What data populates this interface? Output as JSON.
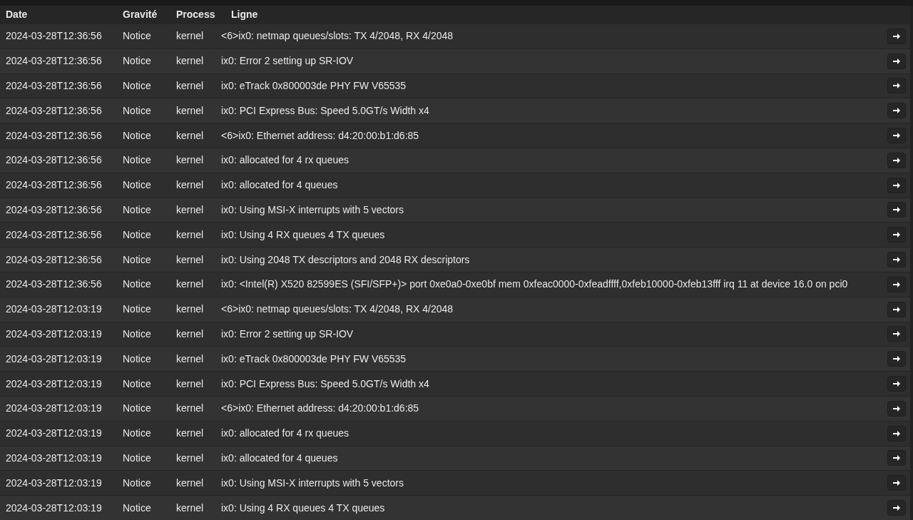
{
  "table": {
    "columns": [
      "Date",
      "Gravité",
      "Process",
      "Ligne"
    ],
    "rows": [
      {
        "date": "2024-03-28T12:36:56",
        "severity": "Notice",
        "process": "kernel",
        "line": "<6>ix0: netmap queues/slots: TX 4/2048, RX 4/2048"
      },
      {
        "date": "2024-03-28T12:36:56",
        "severity": "Notice",
        "process": "kernel",
        "line": "ix0: Error 2 setting up SR-IOV"
      },
      {
        "date": "2024-03-28T12:36:56",
        "severity": "Notice",
        "process": "kernel",
        "line": "ix0: eTrack 0x800003de PHY FW V65535"
      },
      {
        "date": "2024-03-28T12:36:56",
        "severity": "Notice",
        "process": "kernel",
        "line": "ix0: PCI Express Bus: Speed 5.0GT/s Width x4"
      },
      {
        "date": "2024-03-28T12:36:56",
        "severity": "Notice",
        "process": "kernel",
        "line": "<6>ix0: Ethernet address: d4:20:00:b1:d6:85"
      },
      {
        "date": "2024-03-28T12:36:56",
        "severity": "Notice",
        "process": "kernel",
        "line": "ix0: allocated for 4 rx queues"
      },
      {
        "date": "2024-03-28T12:36:56",
        "severity": "Notice",
        "process": "kernel",
        "line": "ix0: allocated for 4 queues"
      },
      {
        "date": "2024-03-28T12:36:56",
        "severity": "Notice",
        "process": "kernel",
        "line": "ix0: Using MSI-X interrupts with 5 vectors"
      },
      {
        "date": "2024-03-28T12:36:56",
        "severity": "Notice",
        "process": "kernel",
        "line": "ix0: Using 4 RX queues 4 TX queues"
      },
      {
        "date": "2024-03-28T12:36:56",
        "severity": "Notice",
        "process": "kernel",
        "line": "ix0: Using 2048 TX descriptors and 2048 RX descriptors"
      },
      {
        "date": "2024-03-28T12:36:56",
        "severity": "Notice",
        "process": "kernel",
        "line": "ix0: <Intel(R) X520 82599ES (SFI/SFP+)> port 0xe0a0-0xe0bf mem 0xfeac0000-0xfeadffff,0xfeb10000-0xfeb13fff irq 11 at device 16.0 on pci0"
      },
      {
        "date": "2024-03-28T12:03:19",
        "severity": "Notice",
        "process": "kernel",
        "line": "<6>ix0: netmap queues/slots: TX 4/2048, RX 4/2048"
      },
      {
        "date": "2024-03-28T12:03:19",
        "severity": "Notice",
        "process": "kernel",
        "line": "ix0: Error 2 setting up SR-IOV"
      },
      {
        "date": "2024-03-28T12:03:19",
        "severity": "Notice",
        "process": "kernel",
        "line": "ix0: eTrack 0x800003de PHY FW V65535"
      },
      {
        "date": "2024-03-28T12:03:19",
        "severity": "Notice",
        "process": "kernel",
        "line": "ix0: PCI Express Bus: Speed 5.0GT/s Width x4"
      },
      {
        "date": "2024-03-28T12:03:19",
        "severity": "Notice",
        "process": "kernel",
        "line": "<6>ix0: Ethernet address: d4:20:00:b1:d6:85"
      },
      {
        "date": "2024-03-28T12:03:19",
        "severity": "Notice",
        "process": "kernel",
        "line": "ix0: allocated for 4 rx queues"
      },
      {
        "date": "2024-03-28T12:03:19",
        "severity": "Notice",
        "process": "kernel",
        "line": "ix0: allocated for 4 queues"
      },
      {
        "date": "2024-03-28T12:03:19",
        "severity": "Notice",
        "process": "kernel",
        "line": "ix0: Using MSI-X interrupts with 5 vectors"
      },
      {
        "date": "2024-03-28T12:03:19",
        "severity": "Notice",
        "process": "kernel",
        "line": "ix0: Using 4 RX queues 4 TX queues"
      }
    ]
  }
}
